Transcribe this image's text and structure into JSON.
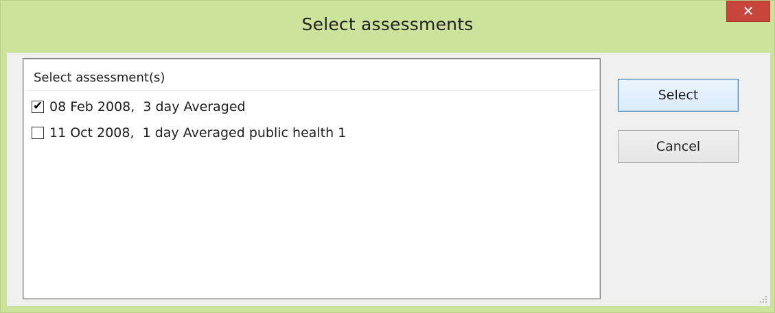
{
  "window": {
    "title": "Select assessments",
    "close_glyph": "✕"
  },
  "list": {
    "header": "Select assessment(s)",
    "items": [
      {
        "label": "08 Feb 2008,  3 day Averaged",
        "checked": true
      },
      {
        "label": "11 Oct 2008,  1 day Averaged public health 1",
        "checked": false
      }
    ]
  },
  "buttons": {
    "select_label": "Select",
    "cancel_label": "Cancel"
  },
  "colors": {
    "titlebar": "#cde29a",
    "close_button": "#c7453b",
    "client_background": "#f0f0f0",
    "default_button_border": "#3c7fb1"
  },
  "icons": {
    "close": "close-icon",
    "check": "checkmark-icon",
    "grip": "resize-grip-icon"
  }
}
